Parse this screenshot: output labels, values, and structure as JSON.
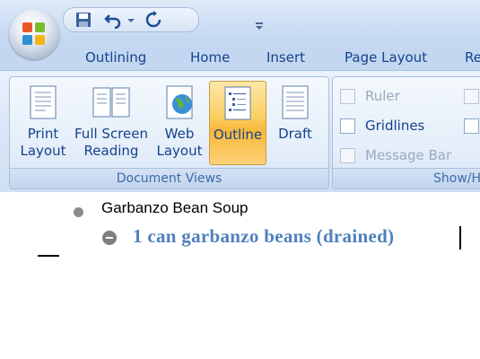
{
  "quick_access": {
    "icons": [
      "save-icon",
      "undo-icon",
      "undo-dropdown-icon",
      "redo-icon",
      "customize-toolbar-icon"
    ]
  },
  "tabs": [
    "Outlining",
    "Home",
    "Insert",
    "Page Layout",
    "Re"
  ],
  "document_views": {
    "group_label": "Document Views",
    "buttons": [
      {
        "label": "Print\nLayout",
        "icon": "print-layout-icon"
      },
      {
        "label": "Full Screen\nReading",
        "icon": "full-screen-reading-icon"
      },
      {
        "label": "Web\nLayout",
        "icon": "web-layout-icon"
      },
      {
        "label": "Outline",
        "icon": "outline-icon",
        "active": true
      },
      {
        "label": "Draft",
        "icon": "draft-icon"
      }
    ]
  },
  "show_hide": {
    "group_label": "Show/H",
    "checkboxes": [
      {
        "label": "Ruler",
        "checked": false,
        "enabled": false
      },
      {
        "label": "Gridlines",
        "checked": false,
        "enabled": true
      },
      {
        "label": "Message Bar",
        "checked": false,
        "enabled": false
      }
    ]
  },
  "document": {
    "level1": "Garbanzo Bean Soup",
    "level2": "1 can garbanzo beans (drained)"
  },
  "colors": {
    "ribbon_text": "#15428b",
    "outline_level2": "#4f81bd",
    "active_button": "#f8b73a"
  }
}
